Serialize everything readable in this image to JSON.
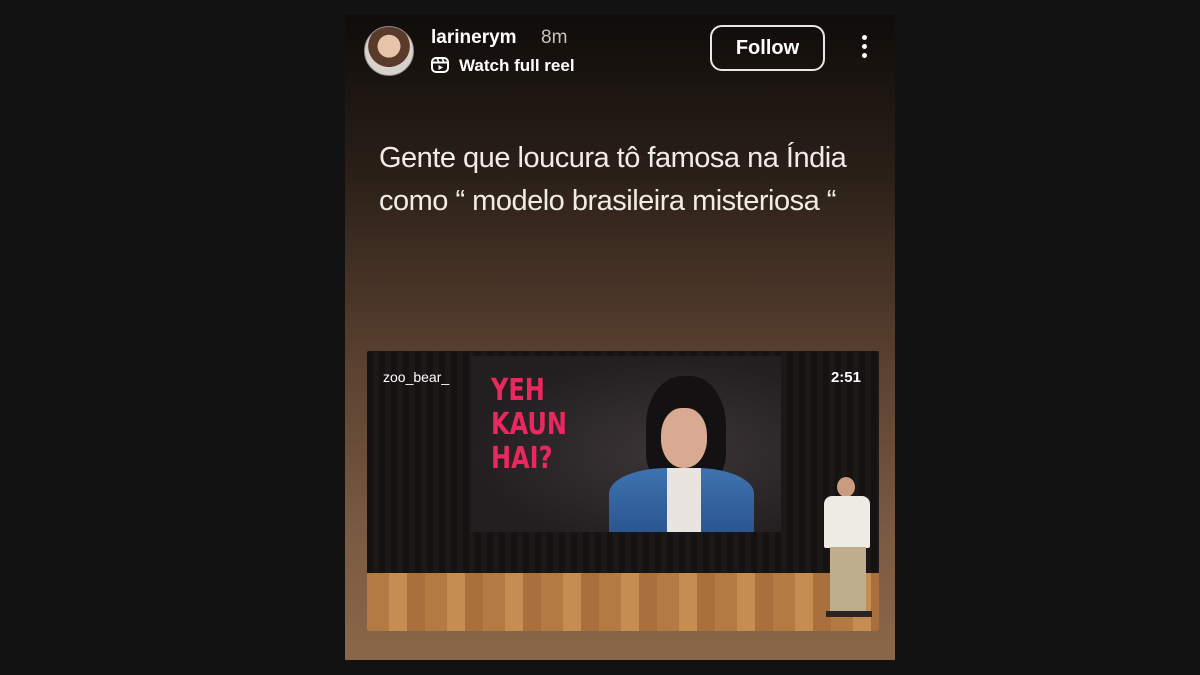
{
  "post": {
    "username": "larinerym",
    "time": "8m",
    "watch_label": "Watch full reel",
    "follow_label": "Follow",
    "caption_line1": "Gente que loucura tô famosa na Índia",
    "caption_line2": "como “ modelo brasileira misteriosa “"
  },
  "reel": {
    "handle": "zoo_bear_",
    "duration": "2:51",
    "screen_text": "YEH\nKAUN\nHAI?"
  },
  "icons": {
    "reel": "reel-icon",
    "more": "more-options-icon"
  },
  "colors": {
    "screen_text": "#e8285e",
    "background": "#121212"
  }
}
